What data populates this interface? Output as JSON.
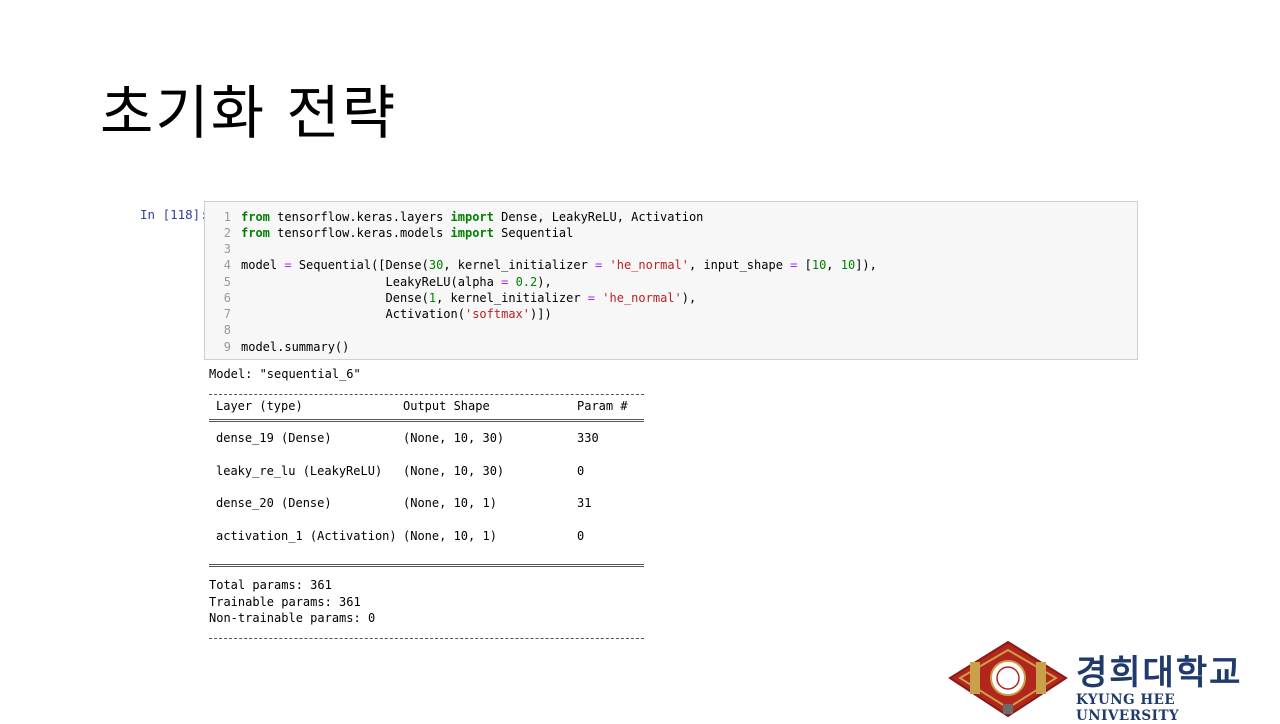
{
  "slide": {
    "title": "초기화 전략"
  },
  "cell": {
    "prompt": "In [118]:",
    "lines": [
      {
        "n": "1",
        "segs": [
          [
            "kw",
            "from"
          ],
          [
            "",
            " tensorflow.keras.layers "
          ],
          [
            "kw",
            "import"
          ],
          [
            "",
            " Dense, LeakyReLU, Activation"
          ]
        ]
      },
      {
        "n": "2",
        "segs": [
          [
            "kw",
            "from"
          ],
          [
            "",
            " tensorflow.keras.models "
          ],
          [
            "kw",
            "import"
          ],
          [
            "",
            " Sequential"
          ]
        ]
      },
      {
        "n": "3",
        "segs": []
      },
      {
        "n": "4",
        "segs": [
          [
            "",
            "model "
          ],
          [
            "op",
            "="
          ],
          [
            "",
            " Sequential([Dense("
          ],
          [
            "num",
            "30"
          ],
          [
            "",
            ", kernel_initializer "
          ],
          [
            "op",
            "="
          ],
          [
            "",
            " "
          ],
          [
            "str",
            "'he_normal'"
          ],
          [
            "",
            ", input_shape "
          ],
          [
            "op",
            "="
          ],
          [
            "",
            " ["
          ],
          [
            "num",
            "10"
          ],
          [
            "",
            ", "
          ],
          [
            "num",
            "10"
          ],
          [
            "",
            "]),"
          ]
        ]
      },
      {
        "n": "5",
        "segs": [
          [
            "",
            "                    LeakyReLU(alpha "
          ],
          [
            "op",
            "="
          ],
          [
            "",
            " "
          ],
          [
            "num",
            "0.2"
          ],
          [
            "",
            "),"
          ]
        ]
      },
      {
        "n": "6",
        "segs": [
          [
            "",
            "                    Dense("
          ],
          [
            "num",
            "1"
          ],
          [
            "",
            ", kernel_initializer "
          ],
          [
            "op",
            "="
          ],
          [
            "",
            " "
          ],
          [
            "str",
            "'he_normal'"
          ],
          [
            "",
            "),"
          ]
        ]
      },
      {
        "n": "7",
        "segs": [
          [
            "",
            "                    Activation("
          ],
          [
            "str",
            "'softmax'"
          ],
          [
            "",
            ")])"
          ]
        ]
      },
      {
        "n": "8",
        "segs": []
      },
      {
        "n": "9",
        "segs": [
          [
            "",
            "model.summary()"
          ]
        ]
      }
    ]
  },
  "summary": {
    "model_line": "Model: \"sequential_6\"",
    "headers": [
      "Layer (type)",
      "Output Shape",
      "Param #"
    ],
    "rows": [
      [
        "dense_19 (Dense)",
        "(None, 10, 30)",
        "330"
      ],
      [
        "leaky_re_lu (LeakyReLU)",
        "(None, 10, 30)",
        "0"
      ],
      [
        "dense_20 (Dense)",
        "(None, 10, 1)",
        "31"
      ],
      [
        "activation_1 (Activation)",
        "(None, 10, 1)",
        "0"
      ]
    ],
    "total": "Total params: 361",
    "trainable": "Trainable params: 361",
    "non_trainable": "Non-trainable params: 0"
  },
  "logo": {
    "korean": "경희대학교",
    "english": "KYUNG HEE UNIVERSITY",
    "colors": {
      "seal_red": "#b3261e",
      "seal_gold": "#c9a14a",
      "text_navy": "#1f3a6b"
    }
  }
}
